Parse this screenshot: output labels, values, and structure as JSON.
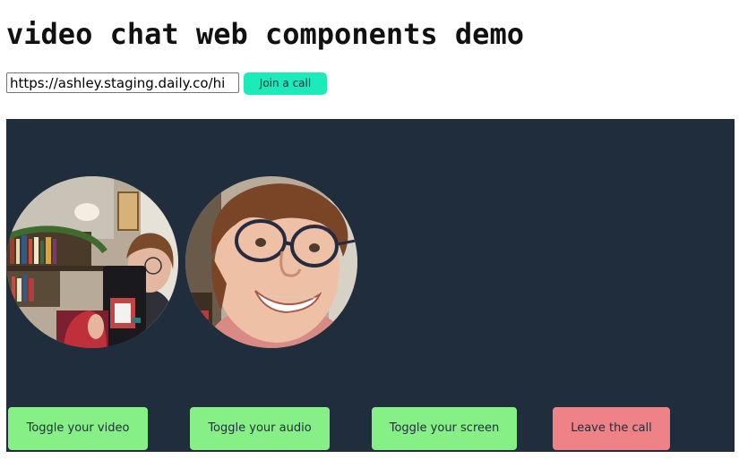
{
  "page": {
    "title": "video chat web components demo"
  },
  "join_form": {
    "url_value": "https://ashley.staging.daily.co/hi",
    "join_label": "Join a call"
  },
  "call": {
    "participants": [
      {
        "kind": "participant-video"
      },
      {
        "kind": "participant-video"
      }
    ],
    "controls": {
      "toggle_video_label": "Toggle your video",
      "toggle_audio_label": "Toggle your audio",
      "toggle_screen_label": "Toggle your screen",
      "leave_label": "Leave the call"
    }
  },
  "colors": {
    "call_background": "#1f2d3d",
    "join_button": "#1bebb9",
    "toggle_button": "#86ef86",
    "leave_button": "#ee8287"
  }
}
